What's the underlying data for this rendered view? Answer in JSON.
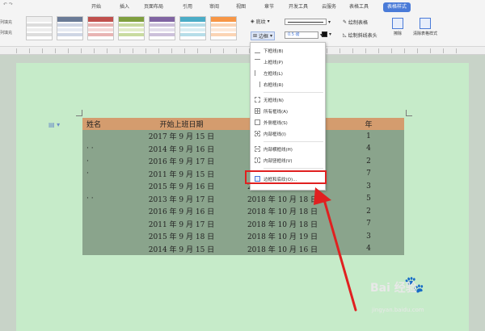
{
  "ribbon": {
    "tabs": [
      "开始",
      "插入",
      "页面布局",
      "引用",
      "审阅",
      "视图",
      "章节",
      "开发工具",
      "云服务",
      "表格工具",
      "表格样式"
    ],
    "active_tab": "表格样式",
    "left_labels": [
      "列填充",
      "列填充"
    ],
    "shading_label": "底纹",
    "border_label": "边框",
    "line_width": "0.5",
    "line_width_unit": "磅",
    "draw_table_label": "绘制表格",
    "draw_diag_label": "绘制斜线表头",
    "erase_label": "擦除",
    "clear_style_label": "清除表格样式"
  },
  "table": {
    "headers": [
      "姓名",
      "开始上班日期",
      "结",
      "",
      "年"
    ],
    "rows": [
      [
        "",
        "2017 年 9 月 15 日",
        "",
        "",
        "1"
      ],
      [
        "· ·",
        "2014 年 9 月 16 日",
        "",
        "",
        "4"
      ],
      [
        "·",
        "2016 年 9 月 17 日",
        "",
        "",
        "2"
      ],
      [
        "·",
        "2011 年 9 月 15 日",
        "",
        "",
        "7"
      ],
      [
        "",
        "2015 年 9 月 16 日",
        "2018 年 10 月 17 日",
        "",
        "3"
      ],
      [
        "· ·",
        "2013 年 9 月 17 日",
        "2018 年 10 月 18 日",
        "",
        "5"
      ],
      [
        "",
        "2016 年 9 月 16 日",
        "2018 年 10 月 18 日",
        "",
        "2"
      ],
      [
        "",
        "2011 年 9 月 17 日",
        "2018 年 10 月 18 日",
        "",
        "7"
      ],
      [
        "",
        "2015 年 9 月 18 日",
        "2018 年 10 月 19 日",
        "",
        "3"
      ],
      [
        "",
        "2014 年 9 月 15 日",
        "2018 年 10 月 16 日",
        "",
        "4"
      ]
    ]
  },
  "border_menu": {
    "items": [
      {
        "label": "下框线(B)",
        "icon": "bottom-border-icon"
      },
      {
        "label": "上框线(P)",
        "icon": "top-border-icon"
      },
      {
        "label": "左框线(L)",
        "icon": "left-border-icon"
      },
      {
        "label": "右框线(R)",
        "icon": "right-border-icon"
      },
      {
        "label": "无框线(N)",
        "icon": "no-border-icon"
      },
      {
        "label": "所有框线(A)",
        "icon": "all-borders-icon"
      },
      {
        "label": "外侧框线(S)",
        "icon": "outside-borders-icon"
      },
      {
        "label": "内部框线(I)",
        "icon": "inside-borders-icon"
      },
      {
        "label": "内部横框线(H)",
        "icon": "inside-horizontal-border-icon"
      },
      {
        "label": "内部竖框线(V)",
        "icon": "inside-vertical-border-icon"
      },
      {
        "label": "边框和底纹(O)...",
        "icon": "borders-and-shading-icon"
      }
    ]
  },
  "watermark": {
    "text": "Bai 经验",
    "sub": "jingyan.baidu.com"
  },
  "colors": {
    "header_bg": "#d49c6e",
    "body_bg": "#8aa48c",
    "page_bg": "#c6ebc9",
    "highlight": "#e02020",
    "accent": "#4a7bd8"
  }
}
